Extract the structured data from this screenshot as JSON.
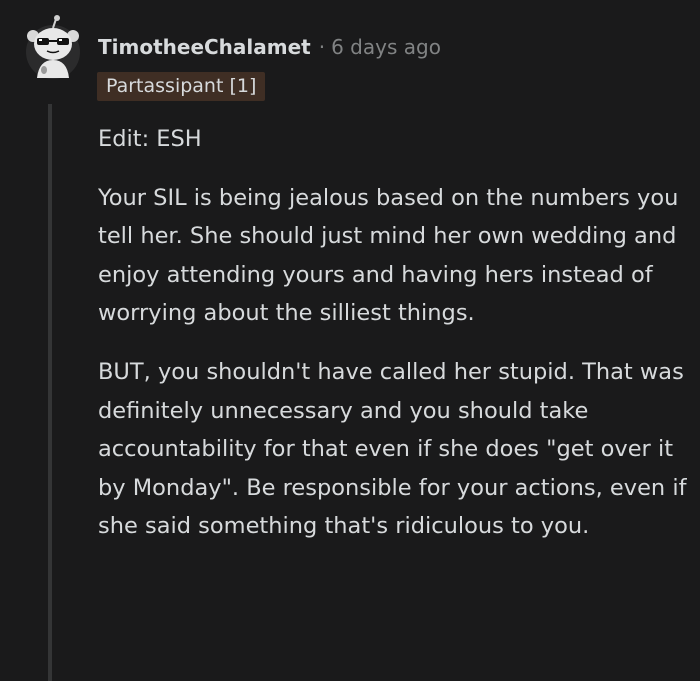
{
  "comment": {
    "username": "TimotheeChalamet",
    "separator": "·",
    "timestamp": "6 days ago",
    "flair": "Partassipant [1]",
    "paragraphs": [
      "Edit: ESH",
      "Your SIL is being jealous based on the numbers you tell her. She should just mind her own wedding and enjoy attending yours and having hers instead of worrying about the silliest things.",
      "BUT, you shouldn't have called her stupid. That was definitely unnecessary and you should take accountability for that even if she does \"get over it by Monday\". Be responsible for your actions, even if she said something that's ridiculous to you."
    ]
  },
  "colors": {
    "background": "#1a1a1b",
    "text": "#d7dadc",
    "meta": "#818384",
    "flair_bg": "#3f2e24",
    "thread_line": "#343536"
  },
  "icons": {
    "avatar": "snoo-avatar-with-sunglasses"
  }
}
